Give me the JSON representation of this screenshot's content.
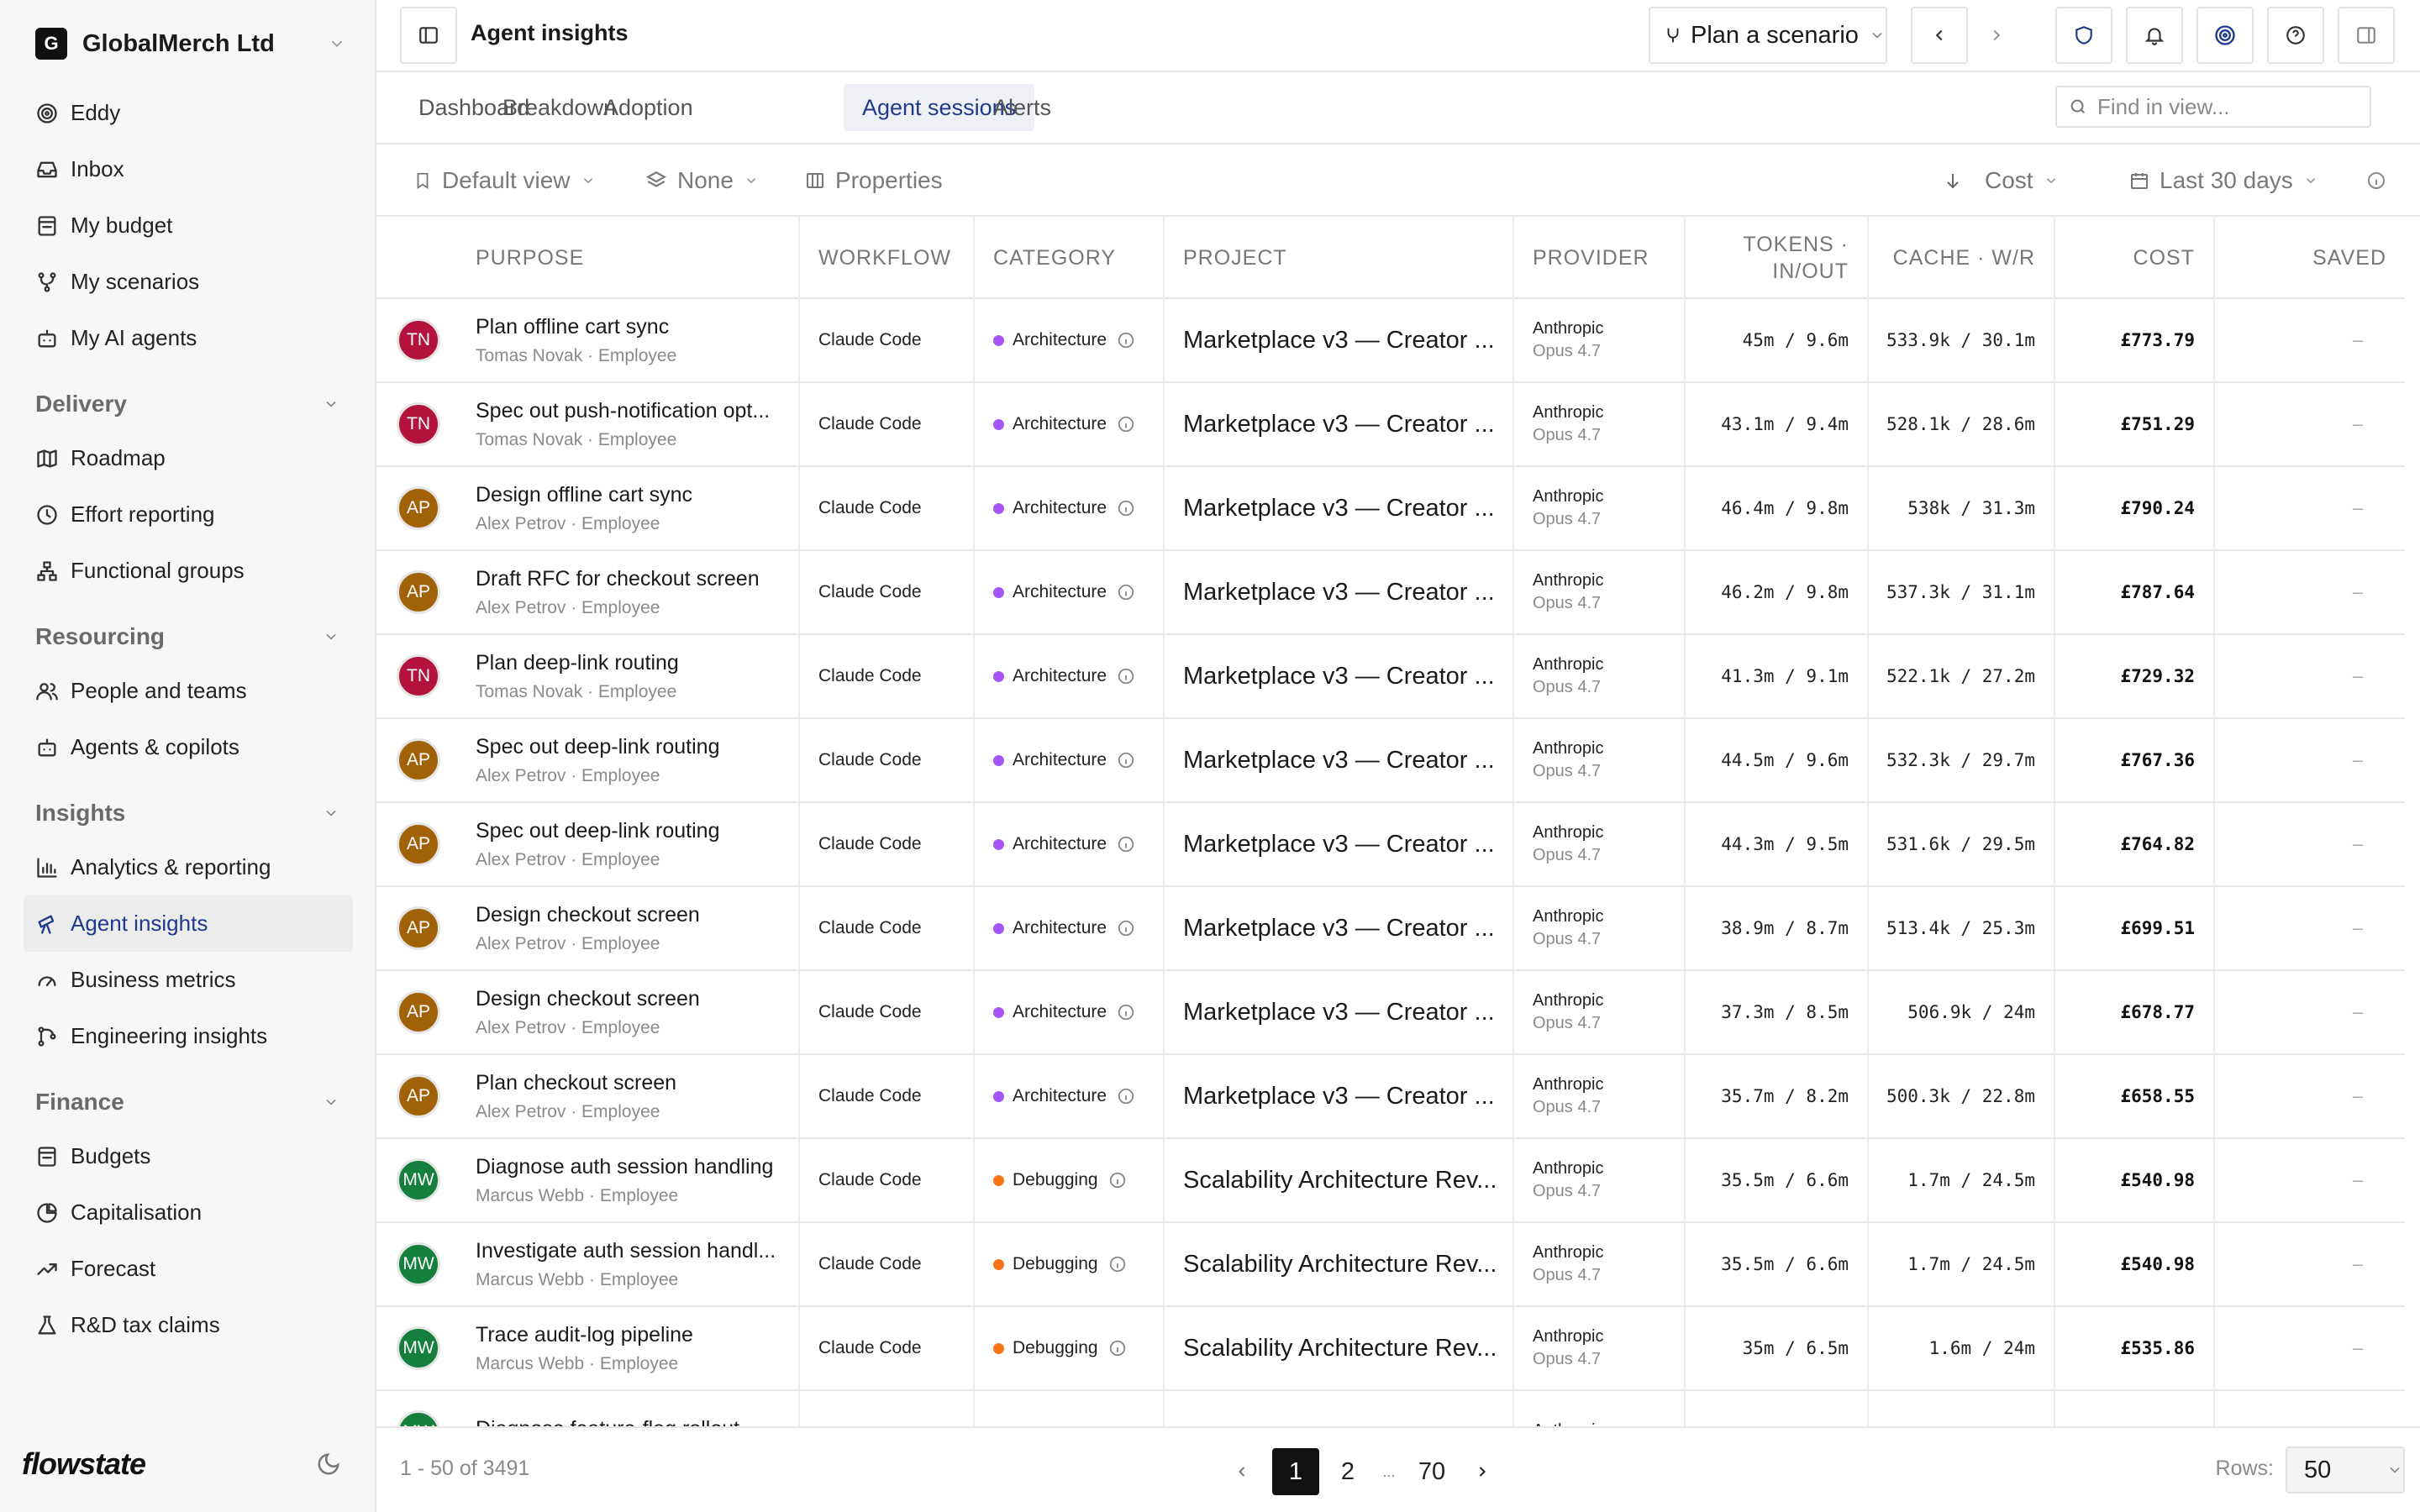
{
  "sidebar": {
    "org_initial": "G",
    "org_name": "GlobalMerch Ltd",
    "top_items": [
      {
        "label": "Eddy",
        "icon": "swirl-icon"
      },
      {
        "label": "Inbox",
        "icon": "inbox-icon"
      },
      {
        "label": "My budget",
        "icon": "wallet-icon"
      },
      {
        "label": "My scenarios",
        "icon": "branch-icon"
      },
      {
        "label": "My AI agents",
        "icon": "robot-icon"
      }
    ],
    "sections": [
      {
        "title": "Delivery",
        "items": [
          {
            "label": "Roadmap",
            "icon": "map-icon"
          },
          {
            "label": "Effort reporting",
            "icon": "clock-icon"
          },
          {
            "label": "Functional groups",
            "icon": "hierarchy-icon"
          }
        ]
      },
      {
        "title": "Resourcing",
        "items": [
          {
            "label": "People and teams",
            "icon": "people-icon"
          },
          {
            "label": "Agents & copilots",
            "icon": "robot-icon"
          }
        ]
      },
      {
        "title": "Insights",
        "items": [
          {
            "label": "Analytics & reporting",
            "icon": "bar-chart-icon"
          },
          {
            "label": "Agent insights",
            "icon": "telescope-icon",
            "active": true
          },
          {
            "label": "Business metrics",
            "icon": "gauge-icon"
          },
          {
            "label": "Engineering insights",
            "icon": "git-icon"
          }
        ]
      },
      {
        "title": "Finance",
        "items": [
          {
            "label": "Budgets",
            "icon": "wallet-icon"
          },
          {
            "label": "Capitalisation",
            "icon": "pie-icon"
          },
          {
            "label": "Forecast",
            "icon": "trend-icon"
          },
          {
            "label": "R&D tax claims",
            "icon": "flask-icon"
          }
        ]
      }
    ],
    "brand": "flowstate"
  },
  "header": {
    "title": "Agent insights",
    "scenario_button": "Plan a scenario"
  },
  "tabs": [
    {
      "label": "Dashboard"
    },
    {
      "label": "Breakdown"
    },
    {
      "label": "Adoption"
    },
    {
      "label": "Agent sessions",
      "active": true
    },
    {
      "label": "Alerts"
    }
  ],
  "search": {
    "placeholder": "Find in view..."
  },
  "toolbar": {
    "view": "Default view",
    "group": "None",
    "properties": "Properties",
    "sort": "Cost",
    "range": "Last 30 days"
  },
  "columns": {
    "purpose": "PURPOSE",
    "workflow": "WORKFLOW",
    "category": "CATEGORY",
    "project": "PROJECT",
    "provider": "PROVIDER",
    "tokens_1": "TOKENS ·",
    "tokens_2": "IN/OUT",
    "cache": "CACHE · W/R",
    "cost": "COST",
    "saved": "SAVED"
  },
  "colors": {
    "TN": "#b3123c",
    "AP": "#a16207",
    "MW": "#15803d",
    "Architecture": "#a855f7",
    "Debugging": "#f97316"
  },
  "rows": [
    {
      "initials": "TN",
      "title": "Plan offline cart sync",
      "person": "Tomas Novak · Employee",
      "workflow": "Claude Code",
      "category": "Architecture",
      "project": "Marketplace v3 — Creator ...",
      "provider": "Anthropic",
      "model": "Opus 4.7",
      "tokens": "45m / 9.6m",
      "cache": "533.9k / 30.1m",
      "cost": "£773.79",
      "saved": "–"
    },
    {
      "initials": "TN",
      "title": "Spec out push-notification opt...",
      "person": "Tomas Novak · Employee",
      "workflow": "Claude Code",
      "category": "Architecture",
      "project": "Marketplace v3 — Creator ...",
      "provider": "Anthropic",
      "model": "Opus 4.7",
      "tokens": "43.1m / 9.4m",
      "cache": "528.1k / 28.6m",
      "cost": "£751.29",
      "saved": "–"
    },
    {
      "initials": "AP",
      "title": "Design offline cart sync",
      "person": "Alex Petrov · Employee",
      "workflow": "Claude Code",
      "category": "Architecture",
      "project": "Marketplace v3 — Creator ...",
      "provider": "Anthropic",
      "model": "Opus 4.7",
      "tokens": "46.4m / 9.8m",
      "cache": "538k / 31.3m",
      "cost": "£790.24",
      "saved": "–"
    },
    {
      "initials": "AP",
      "title": "Draft RFC for checkout screen",
      "person": "Alex Petrov · Employee",
      "workflow": "Claude Code",
      "category": "Architecture",
      "project": "Marketplace v3 — Creator ...",
      "provider": "Anthropic",
      "model": "Opus 4.7",
      "tokens": "46.2m / 9.8m",
      "cache": "537.3k / 31.1m",
      "cost": "£787.64",
      "saved": "–"
    },
    {
      "initials": "TN",
      "title": "Plan deep-link routing",
      "person": "Tomas Novak · Employee",
      "workflow": "Claude Code",
      "category": "Architecture",
      "project": "Marketplace v3 — Creator ...",
      "provider": "Anthropic",
      "model": "Opus 4.7",
      "tokens": "41.3m / 9.1m",
      "cache": "522.1k / 27.2m",
      "cost": "£729.32",
      "saved": "–"
    },
    {
      "initials": "AP",
      "title": "Spec out deep-link routing",
      "person": "Alex Petrov · Employee",
      "workflow": "Claude Code",
      "category": "Architecture",
      "project": "Marketplace v3 — Creator ...",
      "provider": "Anthropic",
      "model": "Opus 4.7",
      "tokens": "44.5m / 9.6m",
      "cache": "532.3k / 29.7m",
      "cost": "£767.36",
      "saved": "–"
    },
    {
      "initials": "AP",
      "title": "Spec out deep-link routing",
      "person": "Alex Petrov · Employee",
      "workflow": "Claude Code",
      "category": "Architecture",
      "project": "Marketplace v3 — Creator ...",
      "provider": "Anthropic",
      "model": "Opus 4.7",
      "tokens": "44.3m / 9.5m",
      "cache": "531.6k / 29.5m",
      "cost": "£764.82",
      "saved": "–"
    },
    {
      "initials": "AP",
      "title": "Design checkout screen",
      "person": "Alex Petrov · Employee",
      "workflow": "Claude Code",
      "category": "Architecture",
      "project": "Marketplace v3 — Creator ...",
      "provider": "Anthropic",
      "model": "Opus 4.7",
      "tokens": "38.9m / 8.7m",
      "cache": "513.4k / 25.3m",
      "cost": "£699.51",
      "saved": "–"
    },
    {
      "initials": "AP",
      "title": "Design checkout screen",
      "person": "Alex Petrov · Employee",
      "workflow": "Claude Code",
      "category": "Architecture",
      "project": "Marketplace v3 — Creator ...",
      "provider": "Anthropic",
      "model": "Opus 4.7",
      "tokens": "37.3m / 8.5m",
      "cache": "506.9k / 24m",
      "cost": "£678.77",
      "saved": "–"
    },
    {
      "initials": "AP",
      "title": "Plan checkout screen",
      "person": "Alex Petrov · Employee",
      "workflow": "Claude Code",
      "category": "Architecture",
      "project": "Marketplace v3 — Creator ...",
      "provider": "Anthropic",
      "model": "Opus 4.7",
      "tokens": "35.7m / 8.2m",
      "cache": "500.3k / 22.8m",
      "cost": "£658.55",
      "saved": "–"
    },
    {
      "initials": "MW",
      "title": "Diagnose auth session handling",
      "person": "Marcus Webb · Employee",
      "workflow": "Claude Code",
      "category": "Debugging",
      "project": "Scalability Architecture Rev...",
      "provider": "Anthropic",
      "model": "Opus 4.7",
      "tokens": "35.5m / 6.6m",
      "cache": "1.7m / 24.5m",
      "cost": "£540.98",
      "saved": "–"
    },
    {
      "initials": "MW",
      "title": "Investigate auth session handl...",
      "person": "Marcus Webb · Employee",
      "workflow": "Claude Code",
      "category": "Debugging",
      "project": "Scalability Architecture Rev...",
      "provider": "Anthropic",
      "model": "Opus 4.7",
      "tokens": "35.5m / 6.6m",
      "cache": "1.7m / 24.5m",
      "cost": "£540.98",
      "saved": "–"
    },
    {
      "initials": "MW",
      "title": "Trace audit-log pipeline",
      "person": "Marcus Webb · Employee",
      "workflow": "Claude Code",
      "category": "Debugging",
      "project": "Scalability Architecture Rev...",
      "provider": "Anthropic",
      "model": "Opus 4.7",
      "tokens": "35m / 6.5m",
      "cache": "1.6m / 24m",
      "cost": "£535.86",
      "saved": "–"
    },
    {
      "initials": "MW",
      "title": "Diagnose feature-flag rollout",
      "person": "",
      "workflow": "",
      "category": "",
      "project": "",
      "provider": "Anthropic",
      "model": "",
      "tokens": "",
      "cache": "",
      "cost": "",
      "saved": ""
    }
  ],
  "footer": {
    "range": "1 - 50 of 3491",
    "pages": [
      "1",
      "2",
      "...",
      "70"
    ],
    "rows_label": "Rows:",
    "rows_value": "50"
  }
}
